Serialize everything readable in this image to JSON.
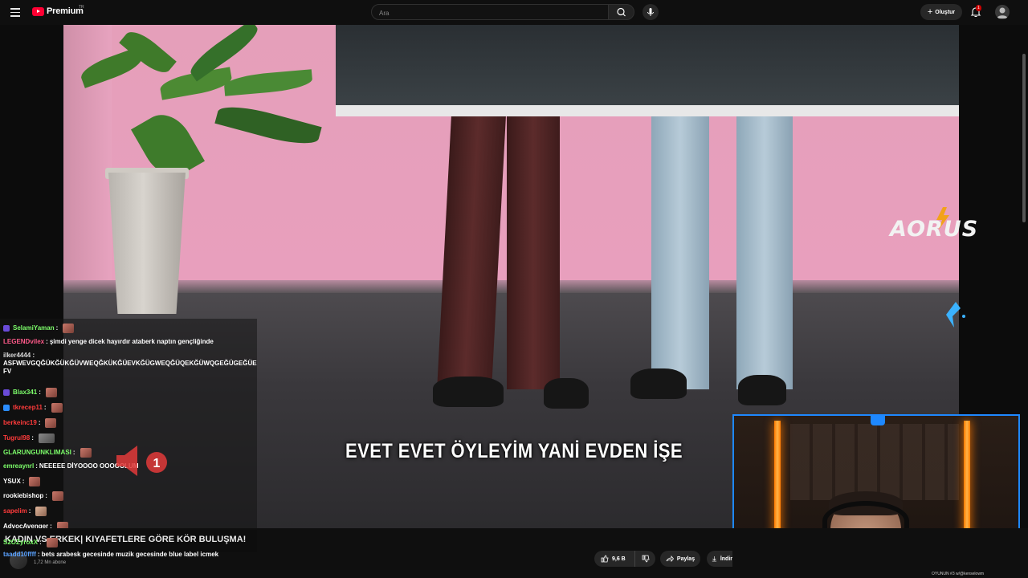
{
  "header": {
    "logo_text": "Premium",
    "logo_sup": "TR",
    "search_placeholder": "Ara",
    "create_label": "Oluştur",
    "notification_count": "1"
  },
  "video": {
    "caption": "EVET EVET ÖYLEYİM YANİ EVDEN İŞE",
    "sponsor_logo": "AORUS"
  },
  "chat": {
    "messages": [
      {
        "user": "SelamiYaman",
        "text": "",
        "color": "#7cfc6a"
      },
      {
        "user": "LEGENDvilex",
        "text": "şimdi yenge dicek hayırdır ataberk naptın gençliğinde",
        "color": "#ff5a8a"
      },
      {
        "user": "ilker4444",
        "text": "ASFWEVGQĞÜKĞÜKĞÜVWEQĞKÜKĞÜEVKĞÜGWEQĞÜQEKĞÜWQGEĞÜGEĞÜEFV",
        "color": "#dddddd"
      },
      {
        "user": "Blax341",
        "text": "",
        "color": "#7cfc6a"
      },
      {
        "user": "tkrecep11",
        "text": "",
        "color": "#ff3b3b"
      },
      {
        "user": "berkeinc19",
        "text": "",
        "color": "#ff3b3b"
      },
      {
        "user": "Tugrul98",
        "text": "",
        "color": "#ff3b3b"
      },
      {
        "user": "GLARUNGUNKLIMASI",
        "text": "",
        "color": "#7cfc6a"
      },
      {
        "user": "emreaynrl",
        "text": "NEEEEE DİYOOOO OOOOOLUM",
        "color": "#7cfc6a"
      },
      {
        "user": "YSUX",
        "text": "",
        "color": "#ffffff"
      },
      {
        "user": "rookiebishop",
        "text": "",
        "color": "#ffffff"
      },
      {
        "user": "sapelim",
        "text": "",
        "color": "#ff3b3b"
      },
      {
        "user": "AdvocAvenger",
        "text": "",
        "color": "#ffffff"
      },
      {
        "user": "S2OZyroxX",
        "text": "",
        "color": "#7cfc6a"
      },
      {
        "user": "taadd10ffff",
        "text": "bets arabesk gecesinde muzik gecesinde blue label icmek",
        "color": "#5aa2ff"
      }
    ],
    "speaker_badge": "1"
  },
  "below": {
    "title": "KADIN VS ERKEK| KIYAFETLERE GÖRE KÖR BULUŞMA!",
    "subscribers": "1,72 Mn abone",
    "likes": "9,6 B",
    "share_label": "Paylaş",
    "download_label": "İndir"
  },
  "webcam": {
    "footer_text": "OYUNUN #3 w/@kenselowm"
  },
  "colors": {
    "accent": "#ff0033",
    "webcam_border": "#1e88ff"
  }
}
